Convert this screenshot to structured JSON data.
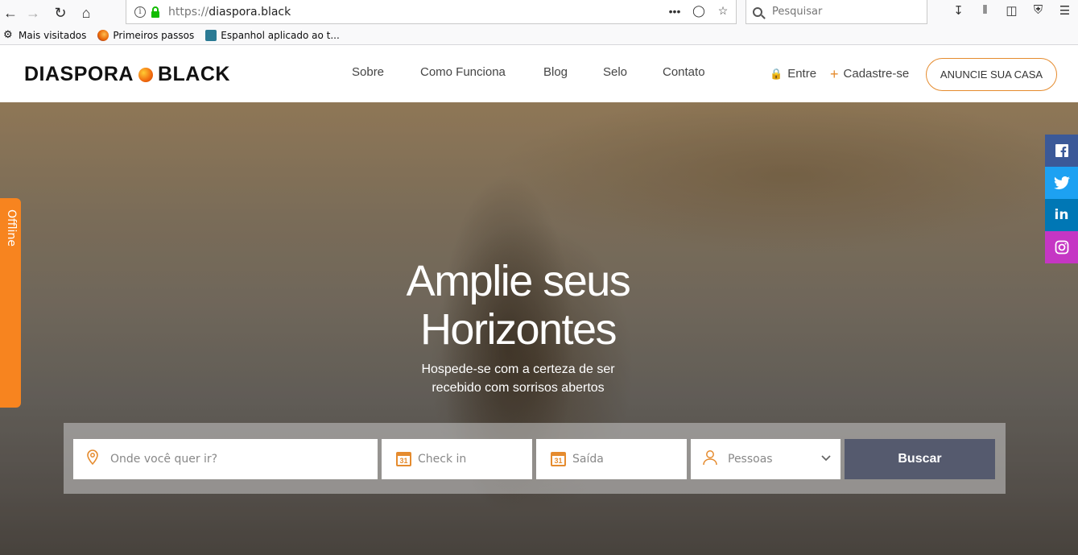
{
  "browser": {
    "url_protocol": "https://",
    "url_host": "diaspora.black",
    "search_placeholder": "Pesquisar"
  },
  "bookmarks": [
    {
      "label": "Mais visitados",
      "icon": "gear-icon"
    },
    {
      "label": "Primeiros passos",
      "icon": "firefox-icon"
    },
    {
      "label": "Espanhol aplicado ao t...",
      "icon": "book-icon"
    }
  ],
  "header": {
    "logo_left": "DIASPORA",
    "logo_right": "BLACK",
    "nav": [
      "Sobre",
      "Como Funciona",
      "Blog",
      "Selo",
      "Contato"
    ],
    "login": "Entre",
    "signup": "Cadastre-se",
    "cta": "ANUNCIE SUA CASA"
  },
  "hero": {
    "title_line1": "Amplie seus",
    "title_line2": "Horizontes",
    "subtitle_line1": "Hospede-se com a certeza de ser",
    "subtitle_line2": "recebido com sorrisos abertos"
  },
  "search": {
    "destination_placeholder": "Onde você quer ir?",
    "checkin_placeholder": "Check in",
    "checkout_placeholder": "Saída",
    "guests_label": "Pessoas",
    "submit": "Buscar",
    "calendar_day": "31"
  },
  "offline_tab": "Offline",
  "colors": {
    "accent": "#e58b2e",
    "button": "#555a6e",
    "facebook": "#3b5998",
    "twitter": "#1da1f2",
    "linkedin": "#0077b5",
    "instagram": "#c536c4",
    "offline": "#f7841f"
  },
  "social": [
    {
      "name": "facebook-icon",
      "glyph": "f"
    },
    {
      "name": "twitter-icon",
      "glyph": "t"
    },
    {
      "name": "linkedin-icon",
      "glyph": "in"
    },
    {
      "name": "instagram-icon",
      "glyph": "◎"
    }
  ]
}
